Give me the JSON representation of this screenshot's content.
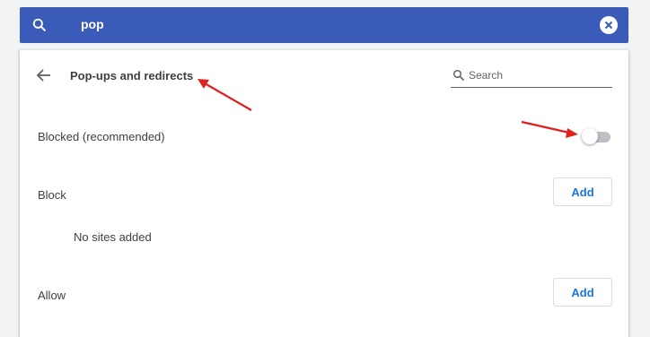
{
  "search": {
    "query": "pop",
    "icon": "search-icon",
    "clear_icon": "close-circle-icon"
  },
  "page": {
    "title": "Pop-ups and redirects",
    "back_icon": "arrow-back-icon",
    "search_placeholder": "Search"
  },
  "settings": {
    "blocked_label": "Blocked (recommended)",
    "blocked_toggle_on": false,
    "block_section": {
      "label": "Block",
      "add_label": "Add",
      "empty_text": "No sites added"
    },
    "allow_section": {
      "label": "Allow",
      "add_label": "Add"
    }
  },
  "colors": {
    "header_blue": "#3a5cb8",
    "accent": "#1a73e8",
    "annotation_red": "#e0201f"
  }
}
